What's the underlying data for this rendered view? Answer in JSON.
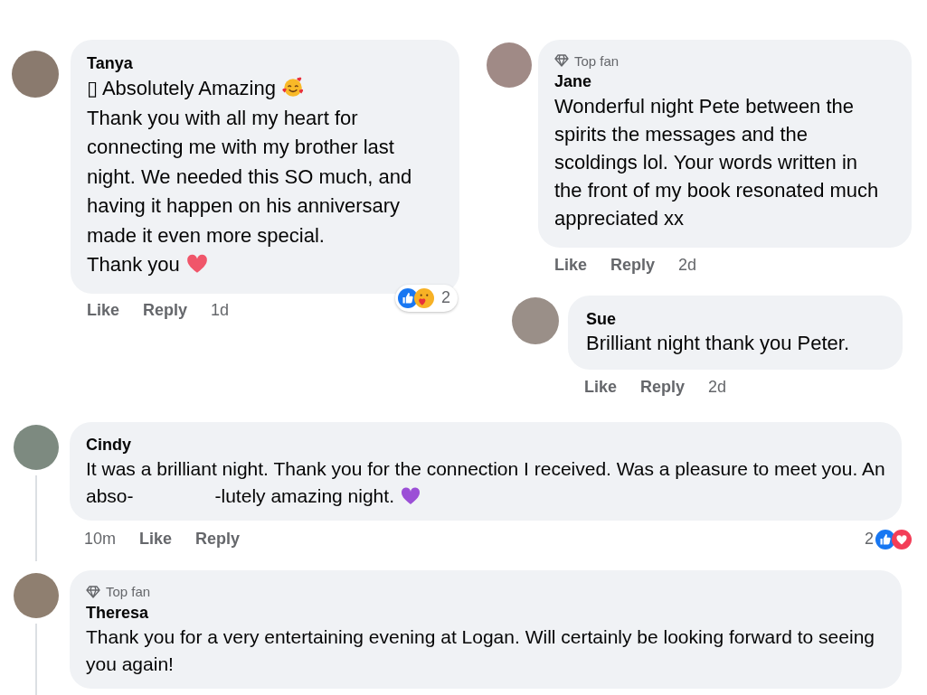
{
  "left_column": [
    {
      "author": "Tanya",
      "paragraphs": [
        {
          "text": "▯ Absolutely Amazing",
          "emoji": {
            "kind": "smiling-hearts"
          }
        },
        {
          "text": "Thank you with all my heart for connecting me with my brother last night. We needed this SO much, and having it happen on his anniversary made it even more special."
        },
        {
          "text": "Thank you",
          "emoji": {
            "kind": "heart"
          }
        }
      ],
      "actions": [
        {
          "kind": "like",
          "label": "Like"
        },
        {
          "kind": "reply",
          "label": "Reply"
        },
        {
          "kind": "time",
          "label": "1d"
        }
      ],
      "reactions": {
        "icons": [
          {
            "kind": "like"
          },
          {
            "kind": "care"
          }
        ],
        "count": "2"
      }
    }
  ],
  "right_column": [
    {
      "author": "Jane",
      "badge": "Top fan",
      "paragraphs": [
        {
          "text": "Wonderful night Pete between the spirits the messages and the scoldings lol. Your words written in the front of my book resonated much appreciated xx"
        }
      ],
      "actions": [
        {
          "kind": "like",
          "label": "Like"
        },
        {
          "kind": "reply",
          "label": "Reply"
        },
        {
          "kind": "time",
          "label": "2d"
        }
      ],
      "replies": [
        {
          "author": "Sue",
          "paragraphs": [
            {
              "text": "Brilliant night thank you Peter."
            }
          ],
          "actions": [
            {
              "kind": "like",
              "label": "Like"
            },
            {
              "kind": "reply",
              "label": "Reply"
            },
            {
              "kind": "time",
              "label": "2d"
            }
          ]
        }
      ]
    }
  ],
  "comments": [
    {
      "author": "Cindy",
      "thread": true,
      "paragraphs": [
        {
          "text": "It was a brilliant night. Thank you for the connection I received. Was a pleasure to meet you. An abso-",
          "text_after_gap": "-lutely amazing night.",
          "emoji": {
            "kind": "purple-heart"
          }
        }
      ],
      "actions": [
        {
          "kind": "time",
          "label": "10m"
        },
        {
          "kind": "like",
          "label": "Like"
        },
        {
          "kind": "reply",
          "label": "Reply"
        }
      ],
      "reactions": {
        "icons": [
          {
            "kind": "like"
          },
          {
            "kind": "love"
          }
        ],
        "count": "2"
      }
    },
    {
      "author": "Theresa",
      "badge": "Top fan",
      "thread": true,
      "paragraphs": [
        {
          "text": "Thank you for a very entertaining evening at Logan. Will certainly be looking forward to seeing you again!"
        }
      ]
    }
  ]
}
